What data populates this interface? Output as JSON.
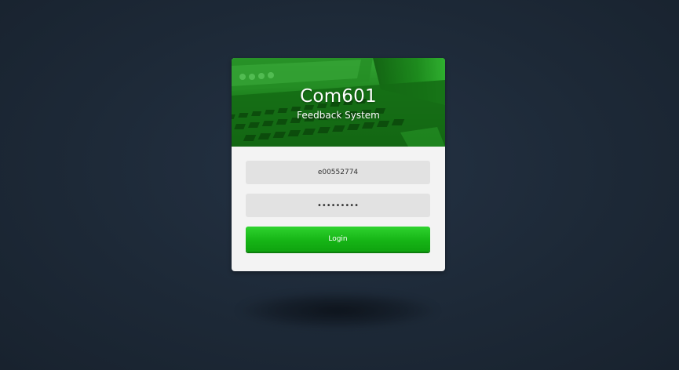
{
  "app": {
    "title": "Com601",
    "subtitle": "Feedback System"
  },
  "login_form": {
    "username_value": "e00552774",
    "password_value": "•••••••••",
    "login_label": "Login"
  },
  "colors": {
    "accent": "#1fc41f",
    "background": "#1e2a38",
    "card": "#f3f3f3",
    "field": "#e2e2e2"
  }
}
